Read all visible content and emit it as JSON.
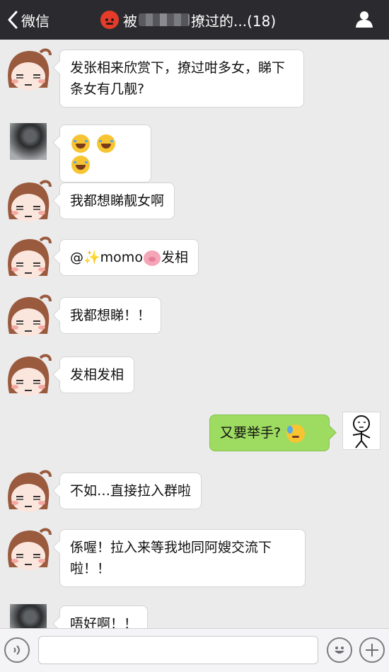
{
  "header": {
    "back_label": "微信",
    "title_prefix": "被",
    "title_suffix": "撩过的...(18)"
  },
  "messages": [
    {
      "side": "left",
      "avatar": "cartoon-girl",
      "text": "发张相来欣赏下，撩过咁多女，睇下条女有几靓?"
    },
    {
      "side": "left",
      "avatar": "photo",
      "emoji": [
        "face-tears-of-joy",
        "face-tears-of-joy",
        "face-tears-of-joy"
      ]
    },
    {
      "side": "left",
      "avatar": "cartoon-girl",
      "text": "我都想睇靓女啊"
    },
    {
      "side": "left",
      "avatar": "cartoon-girl",
      "pre": "@",
      "post_name": "momo",
      "post": "发相"
    },
    {
      "side": "left",
      "avatar": "cartoon-girl",
      "text": "我都想睇！！"
    },
    {
      "side": "left",
      "avatar": "cartoon-girl",
      "text": "发相发相"
    },
    {
      "side": "right",
      "avatar": "stick-figure",
      "text": "又要举手?"
    },
    {
      "side": "left",
      "avatar": "cartoon-girl",
      "text": "不如…直接拉入群啦"
    },
    {
      "side": "left",
      "avatar": "cartoon-girl",
      "text": "係喔！拉入来等我地同阿嫂交流下啦！！"
    },
    {
      "side": "left",
      "avatar": "photo",
      "text": "唔好啊！！"
    }
  ],
  "colors": {
    "header_bg": "#2b2b2f",
    "chat_bg": "#ebebeb",
    "bubble_self": "#9edb61",
    "bubble_other": "#ffffff"
  }
}
